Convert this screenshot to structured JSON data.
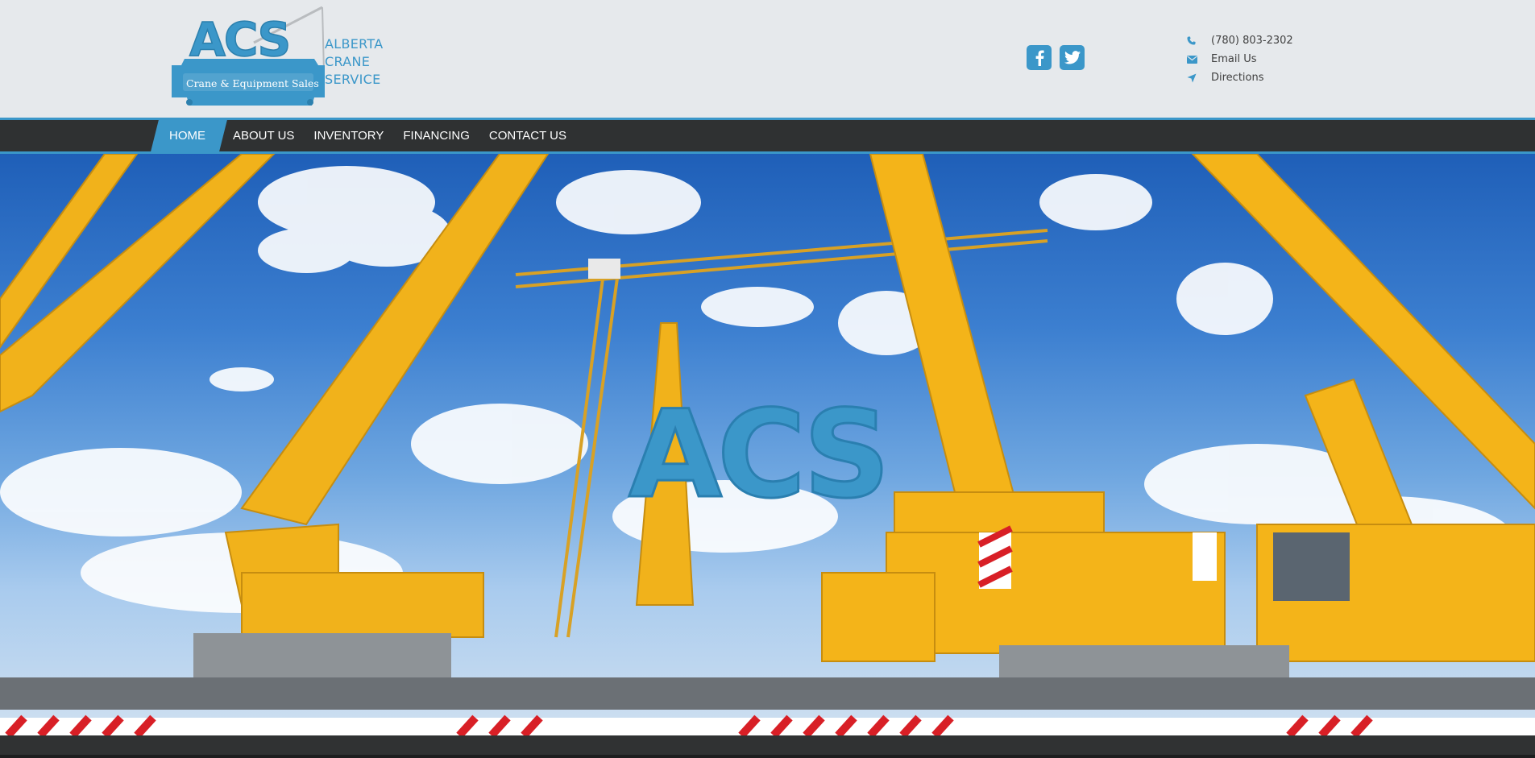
{
  "brand": {
    "logo_letters": "ACS",
    "logo_subtitle": "Crane & Equipment Sales",
    "name_lines": [
      "ALBERTA",
      "CRANE",
      "SERVICE"
    ],
    "accent_color": "#3b97c9"
  },
  "social": [
    {
      "name": "facebook",
      "icon": "facebook-icon"
    },
    {
      "name": "twitter",
      "icon": "twitter-icon"
    }
  ],
  "contact": {
    "phone": "(780) 803-2302",
    "email_label": "Email Us",
    "directions_label": "Directions"
  },
  "nav": {
    "items": [
      {
        "label": "HOME",
        "active": true
      },
      {
        "label": "ABOUT US",
        "active": false
      },
      {
        "label": "INVENTORY",
        "active": false
      },
      {
        "label": "FINANCING",
        "active": false
      },
      {
        "label": "CONTACT US",
        "active": false
      }
    ]
  },
  "hero": {
    "overlay_logo_letters": "ACS",
    "image_description_icon": "crane-yard-photo"
  }
}
